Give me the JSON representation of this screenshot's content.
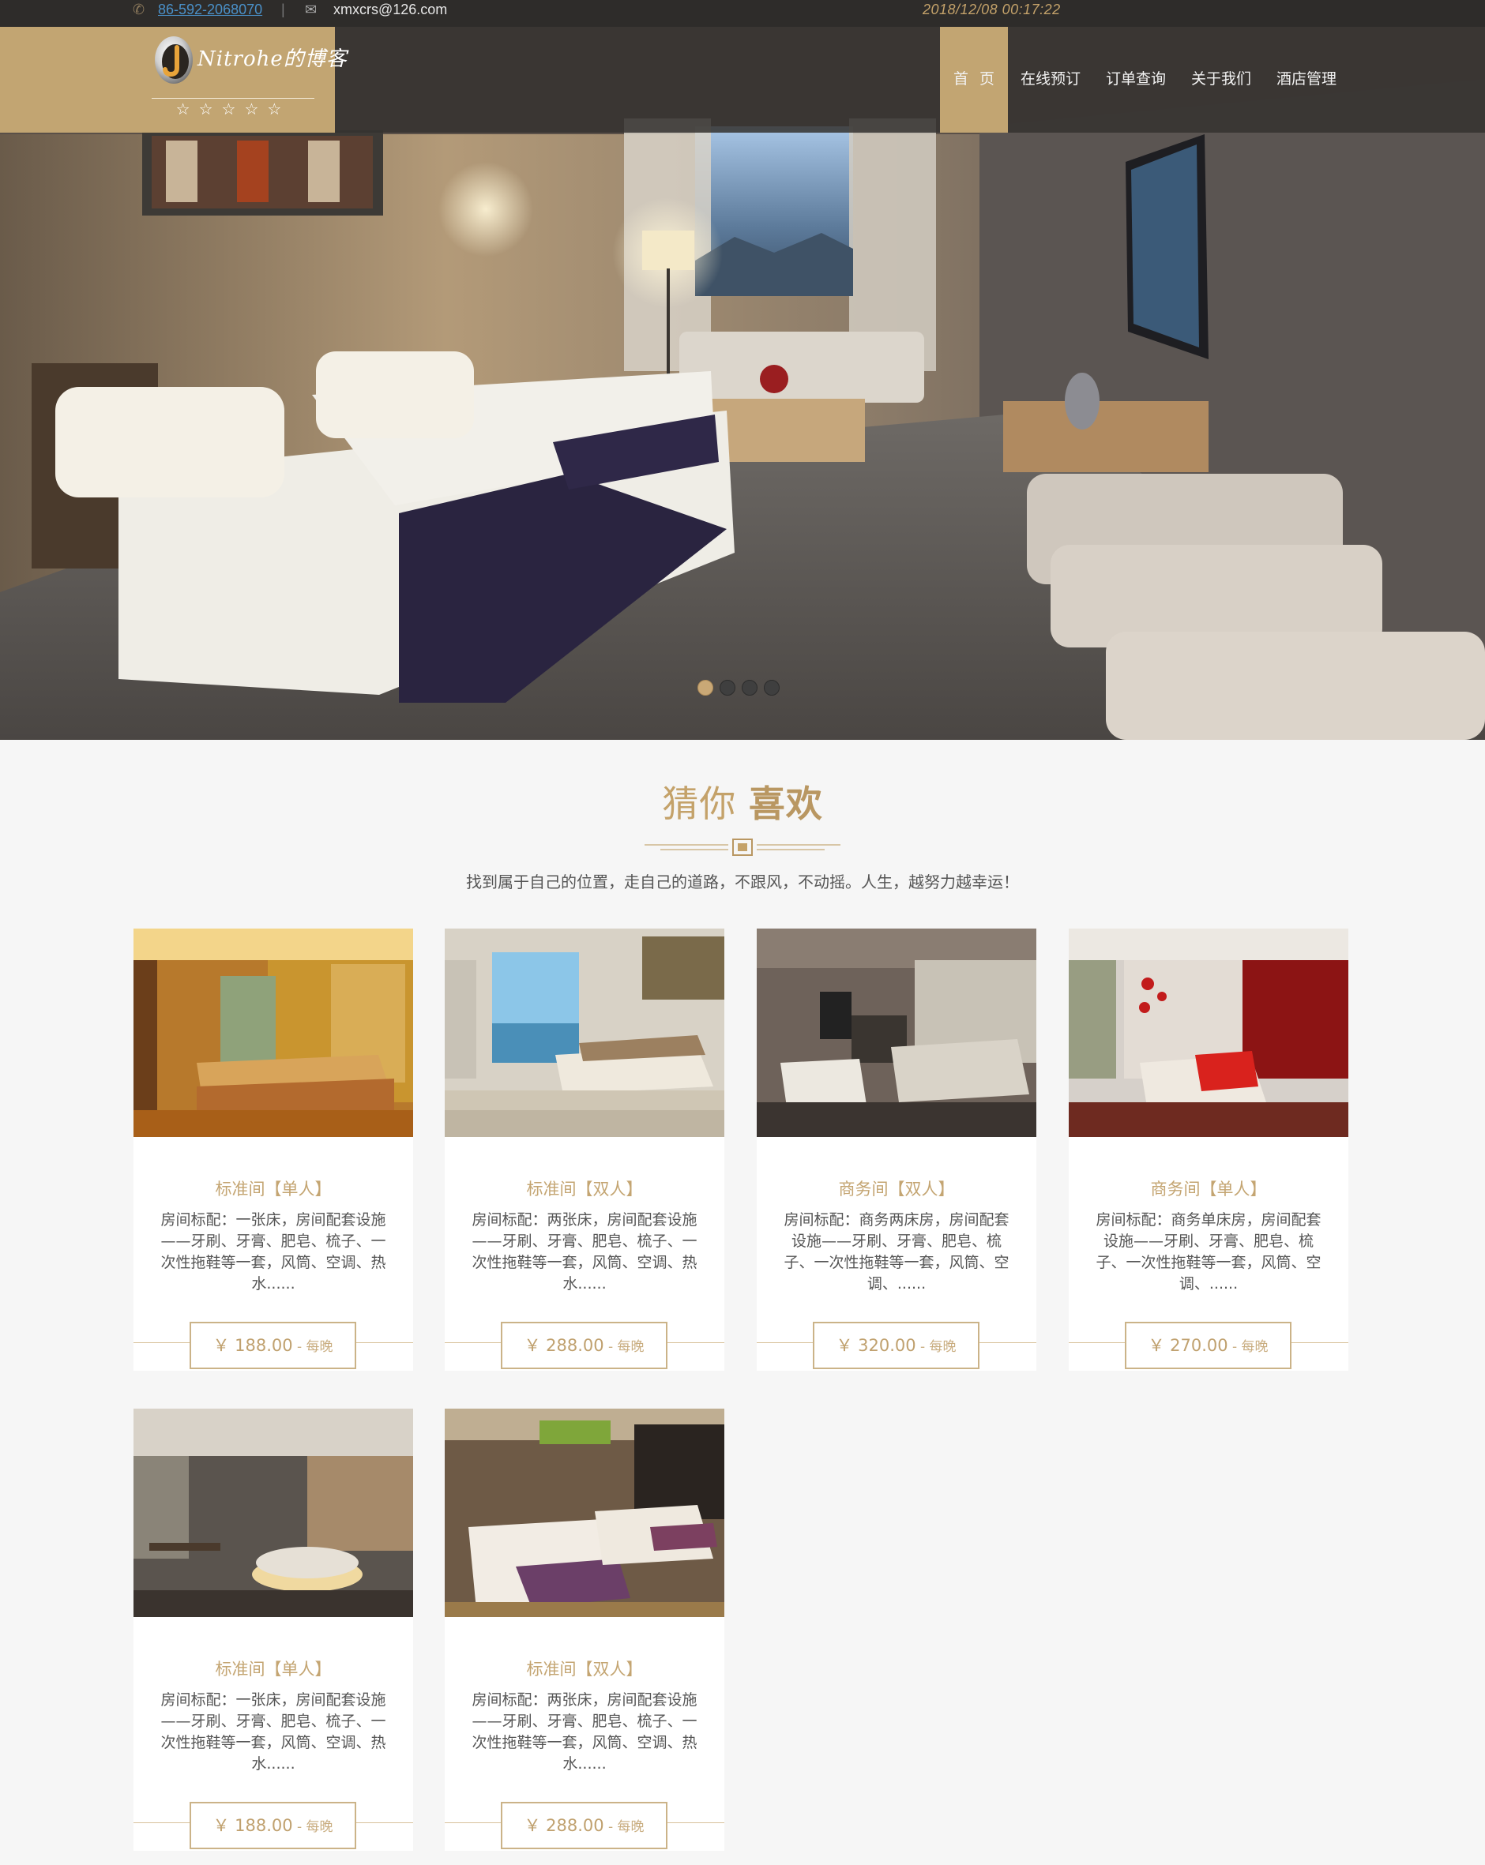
{
  "topbar": {
    "phone_icon": "phone-icon",
    "phone": "86-592-2068070",
    "separator": "|",
    "mail_icon": "envelope-icon",
    "email": "xmxcrs@126.com",
    "datetime": "2018/12/08 00:17:22"
  },
  "brand": {
    "logo_text": "Nitrohe的博客",
    "stars": "☆☆☆☆☆"
  },
  "nav": {
    "items": [
      {
        "label": "首页",
        "active": true
      },
      {
        "label": "在线预订"
      },
      {
        "label": "订单查询"
      },
      {
        "label": "关于我们"
      },
      {
        "label": "酒店管理"
      }
    ]
  },
  "carousel": {
    "slide_count": 4,
    "active_index": 0
  },
  "section": {
    "title_light": "猜你",
    "title_bold": "喜欢",
    "subtitle": "找到属于自己的位置，走自己的道路，不跟风，不动摇。人生，越努力越幸运！"
  },
  "rooms": [
    {
      "title": "标准间【单人】",
      "desc": "房间标配：一张床，房间配套设施——牙刷、牙膏、肥皂、梳子、一次性拖鞋等一套，风筒、空调、热水......",
      "price": "￥ 188.00",
      "per": " - 每晚"
    },
    {
      "title": "标准间【双人】",
      "desc": "房间标配：两张床，房间配套设施——牙刷、牙膏、肥皂、梳子、一次性拖鞋等一套，风筒、空调、热水......",
      "price": "￥ 288.00",
      "per": " - 每晚"
    },
    {
      "title": "商务间【双人】",
      "desc": "房间标配：商务两床房，房间配套设施——牙刷、牙膏、肥皂、梳子、一次性拖鞋等一套，风筒、空调、......",
      "price": "￥ 320.00",
      "per": " - 每晚"
    },
    {
      "title": "商务间【单人】",
      "desc": "房间标配：商务单床房，房间配套设施——牙刷、牙膏、肥皂、梳子、一次性拖鞋等一套，风筒、空调、......",
      "price": "￥ 270.00",
      "per": " - 每晚"
    },
    {
      "title": "标准间【单人】",
      "desc": "房间标配：一张床，房间配套设施——牙刷、牙膏、肥皂、梳子、一次性拖鞋等一套，风筒、空调、热水......",
      "price": "￥ 188.00",
      "per": " - 每晚"
    },
    {
      "title": "标准间【双人】",
      "desc": "房间标配：两张床，房间配套设施——牙刷、牙膏、肥皂、梳子、一次性拖鞋等一套，风筒、空调、热水......",
      "price": "￥ 288.00",
      "per": " - 每晚"
    }
  ],
  "colors": {
    "accent_gold": "#c2a572",
    "nav_dark": "#343230",
    "topbar_dark": "#2e2c2a",
    "page_bg": "#f6f6f6"
  }
}
